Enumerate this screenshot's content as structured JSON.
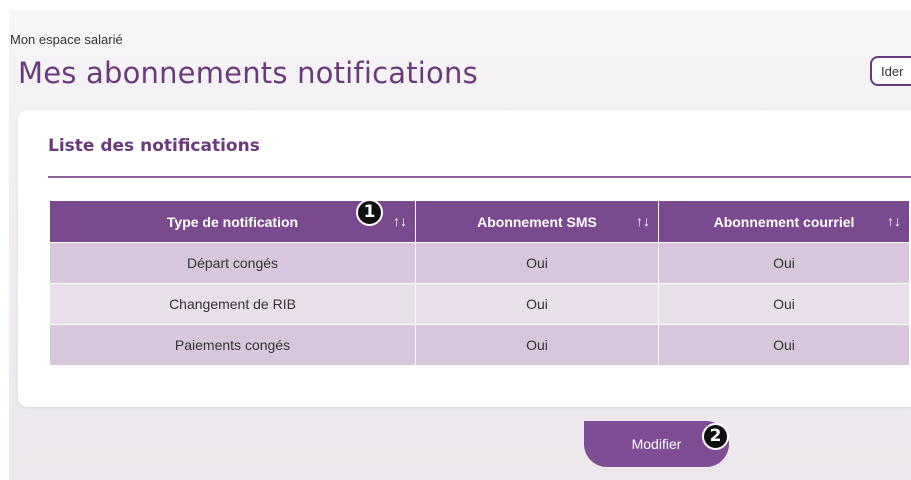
{
  "header": {
    "breadcrumb": "Mon espace salarié",
    "title": "Mes abonnements notifications",
    "ident_button_label": "Ider"
  },
  "card": {
    "title": "Liste des notifications"
  },
  "table": {
    "columns": [
      {
        "label": "Type de notification",
        "sort_icon": "↑↓"
      },
      {
        "label": "Abonnement SMS",
        "sort_icon": "↑↓"
      },
      {
        "label": "Abonnement courriel",
        "sort_icon": "↑↓"
      }
    ],
    "rows": [
      [
        "Départ congés",
        "Oui",
        "Oui"
      ],
      [
        "Changement de RIB",
        "Oui",
        "Oui"
      ],
      [
        "Paiements congés",
        "Oui",
        "Oui"
      ]
    ]
  },
  "actions": {
    "modifier_label": "Modifier"
  },
  "annotations": {
    "badge1": "1",
    "badge2": "2"
  },
  "colors": {
    "accent": "#7a4a8f",
    "title": "#6b3a7d",
    "row_odd": "#d8c7dc",
    "row_even": "#e8dfea"
  }
}
